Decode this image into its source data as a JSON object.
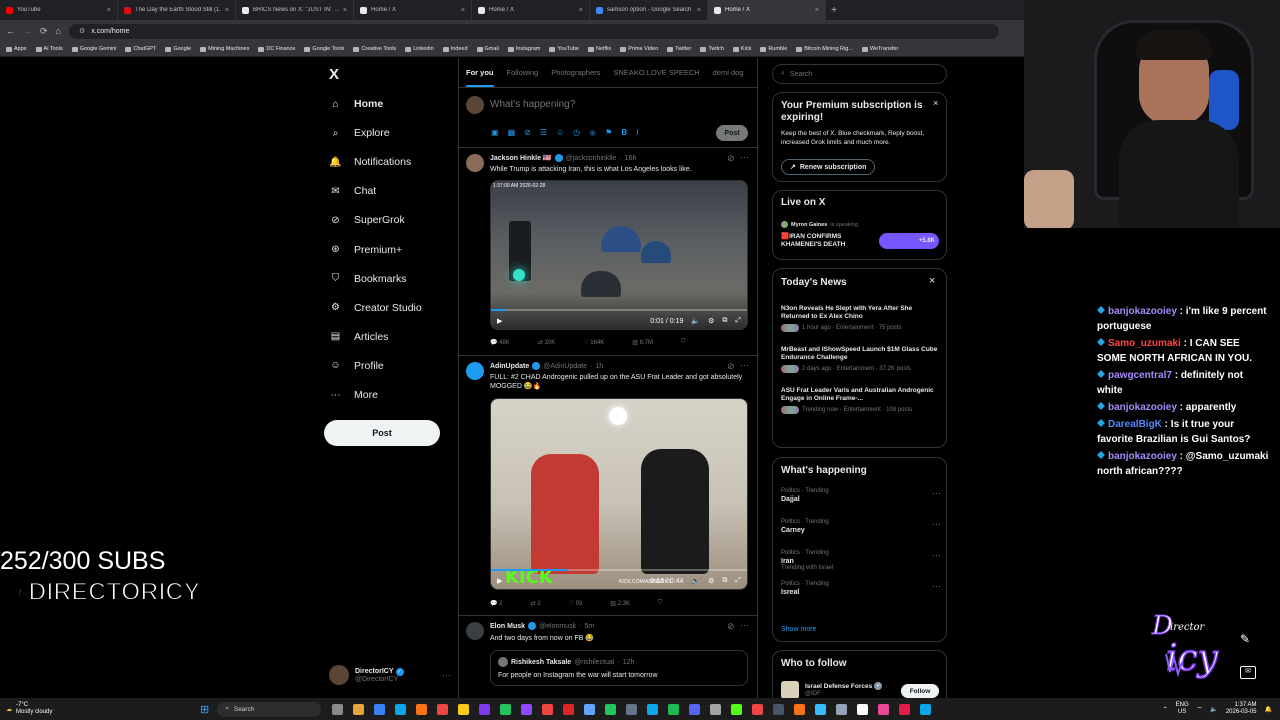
{
  "browser": {
    "tabs": [
      {
        "title": "YouTube",
        "color": "#ff0000"
      },
      {
        "title": "The Day the Earth Stood Still (1...",
        "color": "#e50914"
      },
      {
        "title": "BRICS News on X: \"JUST IN:  ...",
        "color": "#e7e9ea"
      },
      {
        "title": "Home / X",
        "color": "#e7e9ea"
      },
      {
        "title": "Home / X",
        "color": "#e7e9ea"
      },
      {
        "title": "samson option - Google Search",
        "color": "#4285f4"
      },
      {
        "title": "Home / X",
        "color": "#e7e9ea",
        "active": true
      }
    ],
    "url": "x.com/home",
    "bookmarks": [
      "Apps",
      "Ai Tools",
      "Google Gemini",
      "ChatGPT",
      "Google",
      "Mining Machines",
      "DC Finance",
      "Google Tools",
      "Creative Tools",
      "Linkedin",
      "Indeed",
      "Gmail",
      "Instagram",
      "YouTube",
      "Netflix",
      "Prime Video",
      "Twitter",
      "Twitch",
      "Kick",
      "Rumble",
      "Bitcoin Mining Rig...",
      "WeTransfer"
    ]
  },
  "nav": {
    "logo": "X",
    "items": [
      {
        "label": "Home",
        "icon": "home-icon",
        "glyph": "⌂"
      },
      {
        "label": "Explore",
        "icon": "search-icon",
        "glyph": "⌕"
      },
      {
        "label": "Notifications",
        "icon": "bell-icon",
        "glyph": "🔔"
      },
      {
        "label": "Chat",
        "icon": "mail-icon",
        "glyph": "✉"
      },
      {
        "label": "SuperGrok",
        "icon": "grok-icon",
        "glyph": "⊘"
      },
      {
        "label": "Premium+",
        "icon": "verified-icon",
        "glyph": "⊛"
      },
      {
        "label": "Bookmarks",
        "icon": "bookmark-icon",
        "glyph": "⛉"
      },
      {
        "label": "Creator Studio",
        "icon": "creator-icon",
        "glyph": "⚙"
      },
      {
        "label": "Articles",
        "icon": "articles-icon",
        "glyph": "▤"
      },
      {
        "label": "Profile",
        "icon": "profile-icon",
        "glyph": "☺"
      },
      {
        "label": "More",
        "icon": "more-icon",
        "glyph": "⋯"
      }
    ],
    "post_label": "Post",
    "account": {
      "name": "DirectorICY",
      "handle": "@DirectorICY"
    }
  },
  "timeline": {
    "tabs": [
      "For you",
      "Following",
      "Photographers",
      "SNEAKO LOVE SPEECH",
      "demi dog"
    ],
    "compose_placeholder": "What's happening?",
    "post_label": "Post",
    "tweets": [
      {
        "name": "Jackson Hinkle 🇺🇸",
        "handle": "@jacksonhinklle",
        "time": "16h",
        "text": "While Trump is attacking Iran, this is what Los Angeles looks like.",
        "video_time": "0:01 / 0:19",
        "stamp": "1:37:00 AM 2026-02-28",
        "stats": {
          "replies": "48K",
          "reposts": "30K",
          "likes": "164K",
          "views": "8.7M"
        }
      },
      {
        "name": "AdinUpdate",
        "handle": "@AdinUpdate",
        "time": "1h",
        "text": "FULL: #2 CHAD Androgenic pulled up on the ASU Frat Leader and got absolutely MOGGED 😂🔥",
        "video_time": "0:13 / 0:44",
        "overlay": "KICK",
        "overlay_url": "KICK.COM/ADINROSS",
        "stats": {
          "replies": "2",
          "reposts": "2",
          "likes": "93",
          "views": "2.3K"
        }
      },
      {
        "name": "Elon Musk",
        "handle": "@elonmusk",
        "time": "5m",
        "text": "And two days from now on FB 😂",
        "quote": {
          "name": "Rishikesh Taksale",
          "handle": "@rishilectual",
          "time": "12h",
          "text": "For people on Instagram the war will start tomorrow"
        }
      }
    ]
  },
  "sidebar": {
    "search_placeholder": "Search",
    "premium": {
      "title": "Your Premium subscription is expiring!",
      "body": "Keep the best of X. Blue checkmark, Reply boost, increased Grok limits and much more.",
      "button": "Renew subscription"
    },
    "live": {
      "title": "Live on X",
      "host": "Myron Gaines",
      "status": "is speaking",
      "headline": "🟥IRAN CONFIRMS KHAMENEI'S DEATH",
      "count": "+5.8K"
    },
    "news": {
      "title": "Today's News",
      "items": [
        {
          "headline": "N3on Reveals He Slept with Yera After She Returned to Ex Alex Chino",
          "meta": "1 hour ago · Entertainment · 75 posts"
        },
        {
          "headline": "MrBeast and IShowSpeed Launch $1M Glass Cube Endurance Challenge",
          "meta": "2 days ago · Entertainment · 37.2K posts"
        },
        {
          "headline": "ASU Frat Leader Varis and Australian Androgenic Engage in Online Frame-...",
          "meta": "Trending now · Entertainment · 108 posts"
        }
      ]
    },
    "happening": {
      "title": "What's happening",
      "items": [
        {
          "context": "Politics · Trending",
          "topic": "Dajjal"
        },
        {
          "context": "Politics · Trending",
          "topic": "Carney"
        },
        {
          "context": "Politics · Trending",
          "topic": "Iran",
          "extra": "Trending with Israel"
        },
        {
          "context": "Politics · Trending",
          "topic": "Isreal"
        }
      ],
      "show_more": "Show more"
    },
    "follow": {
      "title": "Who to follow",
      "name": "Israel Defense Forces",
      "handle": "@IDF",
      "button": "Follow"
    }
  },
  "overlay": {
    "subs": "252/300 SUBS",
    "handle": "@DIRECTORICY",
    "brand": "Director ICY",
    "chat": [
      {
        "user": "banjokazooiey",
        "color": "#a78bfa",
        "text": "i'm like 9 percent portuguese"
      },
      {
        "user": "Samo_uzumaki",
        "color": "#ff4545",
        "text": "I CAN SEE SOME NORTH AFRICAN IN YOU."
      },
      {
        "user": "pawgcentral7",
        "color": "#a78bfa",
        "text": "definitely not white"
      },
      {
        "user": "banjokazooiey",
        "color": "#a78bfa",
        "text": "apparently"
      },
      {
        "user": "DarealBigK",
        "color": "#4f8bff",
        "text": "Is it true your favorite Brazilian is Gui Santos?"
      },
      {
        "user": "banjokazooiey",
        "color": "#a78bfa",
        "text": "@Samo_uzumaki north african????"
      }
    ]
  },
  "taskbar": {
    "weather_temp": "-7°C",
    "weather_text": "Mostly cloudy",
    "search": "Search",
    "lang": "ENG",
    "region": "US",
    "time": "1:37 AM",
    "date": "2026-03-05"
  }
}
